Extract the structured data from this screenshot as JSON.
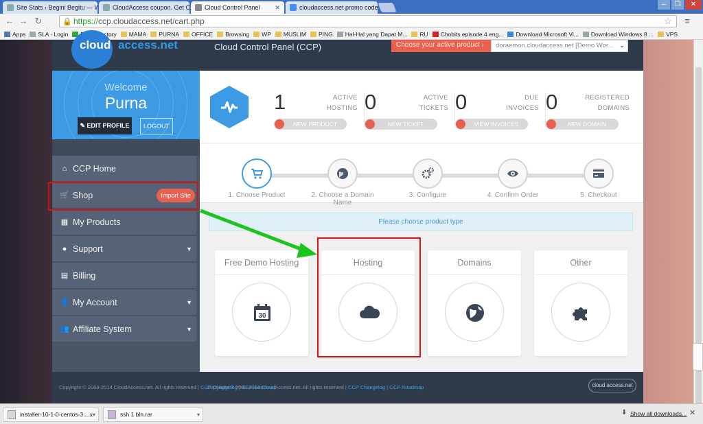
{
  "browser": {
    "tabs": [
      {
        "label": "Site Stats ‹ Begini Begitu — W",
        "active": false
      },
      {
        "label": "CloudAccess coupon. Get Cl",
        "active": false
      },
      {
        "label": "Cloud Control Panel",
        "active": true
      },
      {
        "label": "cloudaccess.net promo code",
        "active": false
      }
    ],
    "url_scheme": "https://",
    "url_rest": "ccp.cloudaccess.net/cart.php",
    "bookmarks": [
      {
        "label": "Apps",
        "icon": "apps-grid-icon"
      },
      {
        "label": "SLA - Login",
        "icon": "page-icon"
      },
      {
        "label": "Forex Factory",
        "icon": "forex-icon"
      },
      {
        "label": "MAMA",
        "icon": "folder-icon"
      },
      {
        "label": "PURNA",
        "icon": "folder-icon"
      },
      {
        "label": "OFFICE",
        "icon": "folder-icon"
      },
      {
        "label": "Browsing",
        "icon": "folder-icon"
      },
      {
        "label": "WP",
        "icon": "folder-icon"
      },
      {
        "label": "MUSLIM",
        "icon": "folder-icon"
      },
      {
        "label": "PING",
        "icon": "folder-icon"
      },
      {
        "label": "Hal-Hal yang Dapat M...",
        "icon": "page-icon"
      },
      {
        "label": "RU",
        "icon": "folder-icon"
      },
      {
        "label": "Chobits episode 4 eng...",
        "icon": "youtube-icon"
      },
      {
        "label": "Download Microsoft Vi...",
        "icon": "windows-icon"
      },
      {
        "label": "Download Windows 8 ...",
        "icon": "page-icon"
      },
      {
        "label": "VPS",
        "icon": "folder-icon"
      }
    ]
  },
  "header": {
    "logo_left": "cloud",
    "logo_right": "access.net",
    "title": "Cloud Control Panel (CCP)",
    "choose_product_label": "Choose your active product",
    "active_product": "doraemon.cloudaccess.net [Demo Wor..."
  },
  "welcome": {
    "label": "Welcome",
    "name": "Purna",
    "edit_profile": "EDIT PROFILE",
    "logout": "LOGOUT"
  },
  "sidebar": {
    "items": [
      {
        "label": "CCP Home",
        "icon": "home-icon",
        "has_caret": false
      },
      {
        "label": "Shop",
        "icon": "cart-icon",
        "has_caret": false,
        "badge": "Import Site"
      },
      {
        "label": "My Products",
        "icon": "grid-icon",
        "has_caret": false
      },
      {
        "label": "Support",
        "icon": "chat-bubble-icon",
        "has_caret": true
      },
      {
        "label": "Billing",
        "icon": "document-icon",
        "has_caret": false
      },
      {
        "label": "My Account",
        "icon": "user-icon",
        "has_caret": true
      },
      {
        "label": "Affiliate System",
        "icon": "users-icon",
        "has_caret": true
      }
    ]
  },
  "stats": [
    {
      "value": "1",
      "label_line1": "ACTIVE",
      "label_line2": "HOSTING",
      "button": "NEW PRODUCT"
    },
    {
      "value": "0",
      "label_line1": "ACTIVE",
      "label_line2": "TICKETS",
      "button": "NEW TICKET"
    },
    {
      "value": "0",
      "label_line1": "DUE",
      "label_line2": "INVOICES",
      "button": "VIEW INVOICES"
    },
    {
      "value": "0",
      "label_line1": "REGISTERED",
      "label_line2": "DOMAINS",
      "button": "NEW DOMAIN"
    }
  ],
  "steps": [
    {
      "label": "1. Choose Product",
      "icon": "cart-icon",
      "active": true
    },
    {
      "label": "2. Choose a Domain Name",
      "icon": "globe-icon",
      "active": false
    },
    {
      "label": "3. Configure",
      "icon": "gears-icon",
      "active": false
    },
    {
      "label": "4. Confirm Order",
      "icon": "eye-icon",
      "active": false
    },
    {
      "label": "5. Checkout",
      "icon": "credit-card-icon",
      "active": false
    }
  ],
  "notice": "Please choose product type",
  "product_types": [
    {
      "label": "Free Demo Hosting",
      "icon": "calendar-icon",
      "icon_text": "30"
    },
    {
      "label": "Hosting",
      "icon": "cloud-icon"
    },
    {
      "label": "Domains",
      "icon": "globe-icon"
    },
    {
      "label": "Other",
      "icon": "puzzle-icon"
    }
  ],
  "footer": {
    "copyright": "Copyright © 2008-2014 CloudAccess.net. All rights reserved |",
    "link1": "CCP Changelog",
    "sep": "|",
    "link2": "CCP Roadmap",
    "logo": "cloud access.net"
  },
  "downloads": [
    {
      "label": "installer-10-1-0-centos-3....x"
    },
    {
      "label": "ssh 1 bln.rar"
    }
  ],
  "show_all_downloads": "Show all downloads...",
  "colors": {
    "accent_blue": "#3d9be6",
    "accent_red": "#e8604f",
    "dark_navy": "#2f3a4b",
    "highlight_red": "#dd1111",
    "arrow_green": "#22cc22"
  }
}
